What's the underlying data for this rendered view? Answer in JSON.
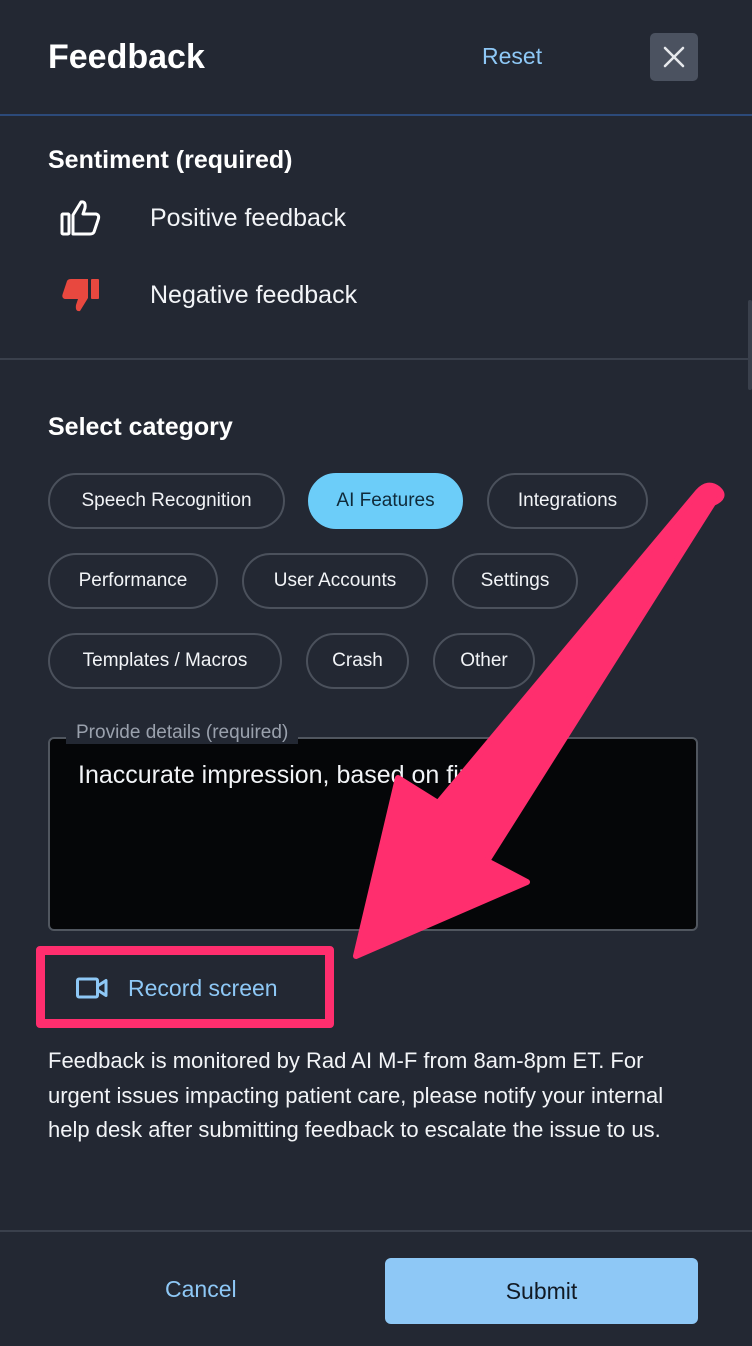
{
  "header": {
    "title": "Feedback",
    "reset_label": "Reset",
    "close_icon": "close-icon"
  },
  "sentiment": {
    "title": "Sentiment (required)",
    "options": [
      {
        "label": "Positive feedback",
        "icon": "thumbs-up-icon",
        "selected": false
      },
      {
        "label": "Negative feedback",
        "icon": "thumbs-down-icon",
        "selected": true,
        "color": "#e8483f"
      }
    ]
  },
  "category": {
    "title": "Select category",
    "chips": [
      {
        "label": "Speech Recognition",
        "selected": false
      },
      {
        "label": "AI Features",
        "selected": true
      },
      {
        "label": "Integrations",
        "selected": false
      },
      {
        "label": "Performance",
        "selected": false
      },
      {
        "label": "User Accounts",
        "selected": false
      },
      {
        "label": "Settings",
        "selected": false
      },
      {
        "label": "Templates / Macros",
        "selected": false
      },
      {
        "label": "Crash",
        "selected": false
      },
      {
        "label": "Other",
        "selected": false
      }
    ]
  },
  "details": {
    "legend": "Provide details (required)",
    "value": "Inaccurate impression, based on findings"
  },
  "record": {
    "label": "Record screen",
    "icon": "video-camera-icon"
  },
  "info_text": "Feedback is monitored by Rad AI M-F from 8am-8pm ET. For urgent issues impacting patient care, please notify your internal help desk after submitting feedback to escalate the issue to us.",
  "footer": {
    "cancel_label": "Cancel",
    "submit_label": "Submit"
  },
  "colors": {
    "background": "#232833",
    "accent": "#8ec8f6",
    "chip_selected": "#6ccdf9",
    "annotation": "#ff2e6e",
    "negative": "#e8483f"
  }
}
